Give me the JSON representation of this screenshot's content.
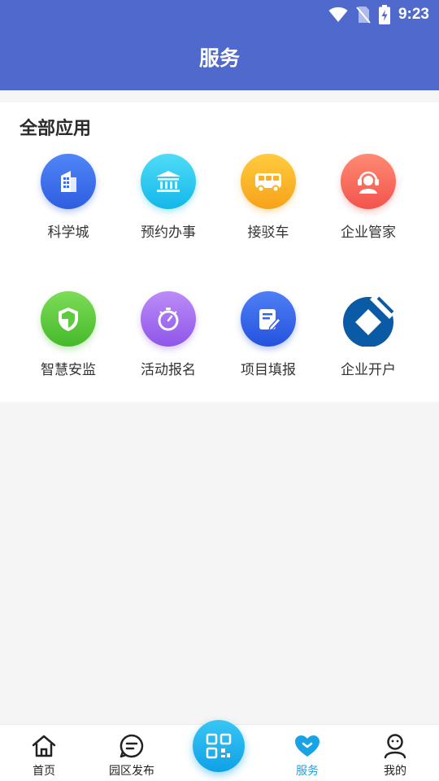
{
  "status_bar": {
    "time": "9:23"
  },
  "header": {
    "title": "服务"
  },
  "section": {
    "title": "全部应用"
  },
  "apps": [
    {
      "label": "科学城",
      "icon": "building-icon",
      "color": "#3d6ef0"
    },
    {
      "label": "预约办事",
      "icon": "bank-icon",
      "color": "#27c9f1"
    },
    {
      "label": "接驳车",
      "icon": "bus-icon",
      "color": "#fbb52a"
    },
    {
      "label": "企业管家",
      "icon": "customer-service-icon",
      "color": "#fa6b5c"
    },
    {
      "label": "智慧安监",
      "icon": "shield-icon",
      "color": "#5ccb3e"
    },
    {
      "label": "活动报名",
      "icon": "stopwatch-icon",
      "color": "#a46df2"
    },
    {
      "label": "项目填报",
      "icon": "form-edit-icon",
      "color": "#3563ea"
    },
    {
      "label": "企业开户",
      "icon": "bank-logo-icon",
      "color": "#0a5aa6"
    }
  ],
  "tabbar": {
    "items": [
      {
        "label": "首页",
        "icon": "home-icon"
      },
      {
        "label": "园区发布",
        "icon": "message-icon"
      },
      {
        "label": "",
        "icon": "qr-scan-icon"
      },
      {
        "label": "服务",
        "icon": "heart-icon",
        "active": true
      },
      {
        "label": "我的",
        "icon": "user-icon"
      }
    ],
    "active_color": "#19a3e6"
  }
}
